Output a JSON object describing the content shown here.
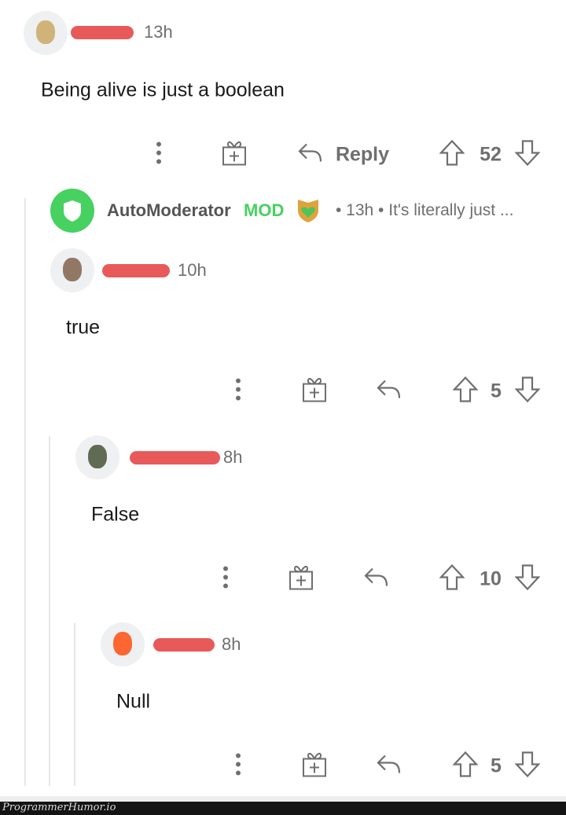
{
  "comments": [
    {
      "time": "13h",
      "body": "Being alive is just a boolean",
      "reply_label": "Reply",
      "score": "52"
    },
    {
      "time": "10h",
      "body": "true",
      "score": "5"
    },
    {
      "time": "8h",
      "body": "False",
      "score": "10"
    },
    {
      "time": "8h",
      "body": "Null",
      "score": "5"
    }
  ],
  "automod": {
    "name": "AutoModerator",
    "mod_label": "MOD",
    "meta": "• 13h • It's literally just ..."
  },
  "colors": {
    "mod_green": "#46d160",
    "redaction": "#e85a5a",
    "text_grey": "#6f6f6f"
  },
  "icons": [
    "more-vertical-icon",
    "gift-award-icon",
    "reply-arrow-icon",
    "upvote-icon",
    "downvote-icon",
    "shield-icon"
  ],
  "footer": {
    "watermark": "ProgrammerHumor.io"
  }
}
